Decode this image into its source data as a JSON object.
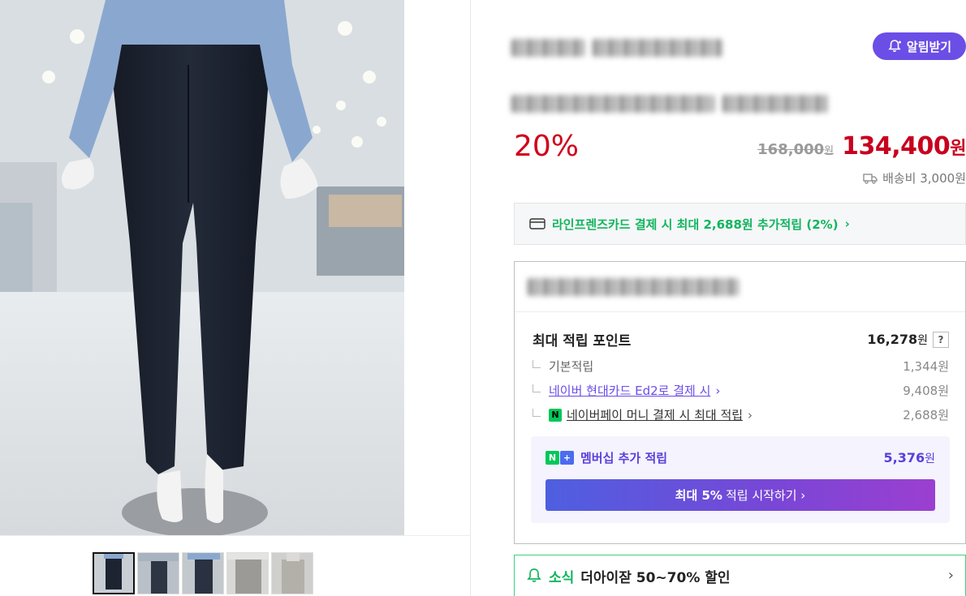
{
  "product": {
    "notify_label": "알림받기",
    "discount": "20%",
    "original_price": "168,000",
    "original_currency": "원",
    "sale_price": "134,400",
    "sale_currency": "원",
    "shipping": "배송비 3,000원"
  },
  "card_banner": {
    "text": "라인프렌즈카드 결제 시 최대 2,688원 추가적립 (2%)",
    "chevron": "›"
  },
  "points": {
    "max_label": "최대 적립 포인트",
    "max_value": "16,278",
    "max_unit": "원",
    "help": "?",
    "rows": [
      {
        "label": "기본적립",
        "value": "1,344원"
      },
      {
        "label": "네이버 현대카드 Ed2로 결제 시",
        "value": "9,408원"
      },
      {
        "label": "네이버페이 머니 결제 시 최대 적립",
        "value": "2,688원"
      }
    ],
    "npay_badge": "N"
  },
  "membership": {
    "label": "멤버십 추가 적립",
    "value": "5,376",
    "unit": "원",
    "badge_n": "N",
    "badge_plus": "+",
    "button_strong": "최대 5%",
    "button_rest": "적립 시작하기 ›"
  },
  "news": {
    "tag": "소식",
    "text": "더아이잗 50~70% 할인",
    "chevron": "›"
  },
  "colors": {
    "accent_purple": "#6b4ee6",
    "price_red": "#c8001e",
    "naver_green": "#12b55f"
  }
}
